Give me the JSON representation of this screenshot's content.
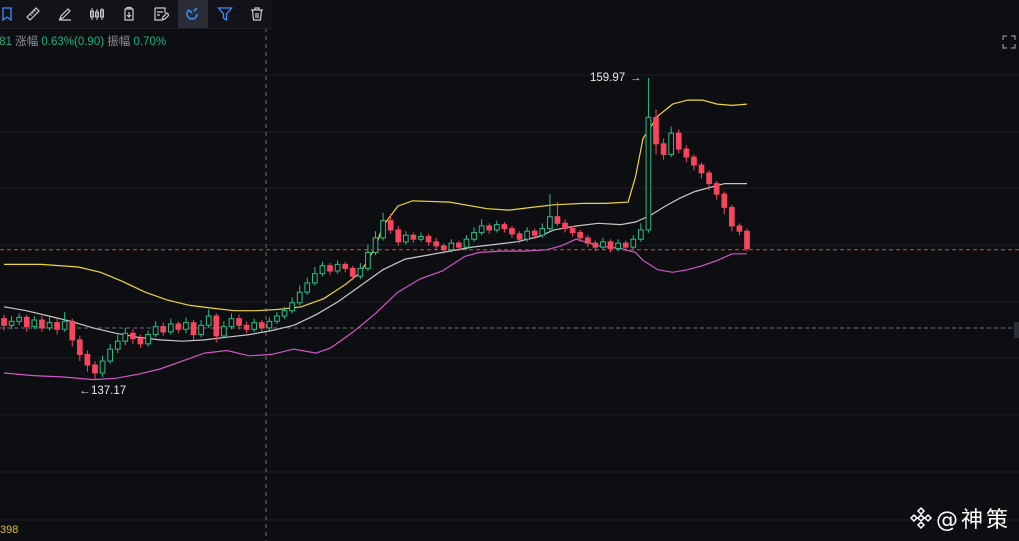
{
  "toolbar": {
    "tools": [
      {
        "name": "bookmark-icon",
        "active": false
      },
      {
        "name": "ruler-icon",
        "active": false
      },
      {
        "name": "pen-icon",
        "active": false
      },
      {
        "name": "candlestick-icon",
        "active": false
      },
      {
        "name": "clipboard-icon",
        "active": false
      },
      {
        "name": "edit-note-icon",
        "active": false
      },
      {
        "name": "magnet-icon",
        "active": true
      },
      {
        "name": "filter-icon",
        "active": false
      },
      {
        "name": "trash-icon",
        "active": false
      }
    ]
  },
  "stats": {
    "partial_value": ".81",
    "change_label": "涨幅",
    "change_value": "0.63%(0.90)",
    "amplitude_label": "振幅",
    "amplitude_value": "0.70%"
  },
  "bottom_value": "398",
  "watermark": {
    "text": "@神策"
  },
  "colors": {
    "up": "#2ebd85",
    "down": "#f6465d",
    "upper_band": "#f0d43a",
    "middle_band": "#c8c8c8",
    "lower_band": "#d455c8",
    "background": "#0d0e12"
  },
  "chart_data": {
    "type": "candlestick",
    "indicator": "bollinger",
    "ylim": [
      133.0,
      163.0
    ],
    "annotations": [
      {
        "text": "159.97",
        "value": 159.97,
        "kind": "high"
      },
      {
        "text": "137.17",
        "value": 137.17,
        "kind": "low"
      }
    ],
    "reference_lines": [
      {
        "value": 147.0,
        "style": "dashed",
        "color": "#d84a4a"
      },
      {
        "value": 141.1,
        "style": "dashed",
        "color": "#6b6e76"
      }
    ],
    "candles": [
      [
        141.8,
        141.3,
        142.1,
        140.9
      ],
      [
        141.3,
        141.6,
        142.0,
        141.0
      ],
      [
        141.6,
        141.9,
        142.2,
        141.3
      ],
      [
        141.9,
        141.2,
        142.1,
        140.8
      ],
      [
        141.2,
        141.7,
        142.0,
        141.0
      ],
      [
        141.7,
        141.1,
        142.0,
        140.8
      ],
      [
        141.1,
        141.5,
        141.9,
        140.9
      ],
      [
        141.5,
        141.0,
        141.8,
        140.6
      ],
      [
        141.0,
        141.6,
        142.3,
        140.8
      ],
      [
        141.6,
        140.2,
        141.8,
        139.7
      ],
      [
        140.2,
        139.1,
        140.5,
        138.6
      ],
      [
        139.1,
        138.3,
        139.4,
        137.8
      ],
      [
        138.3,
        137.7,
        138.6,
        137.17
      ],
      [
        137.7,
        138.6,
        139.0,
        137.4
      ],
      [
        138.6,
        139.5,
        139.9,
        138.4
      ],
      [
        139.5,
        140.1,
        140.6,
        139.2
      ],
      [
        140.1,
        140.7,
        141.1,
        139.8
      ],
      [
        140.7,
        140.3,
        141.0,
        139.9
      ],
      [
        140.3,
        139.9,
        140.6,
        139.6
      ],
      [
        139.9,
        140.6,
        140.9,
        139.7
      ],
      [
        140.6,
        141.2,
        141.6,
        140.4
      ],
      [
        141.2,
        140.8,
        141.5,
        140.5
      ],
      [
        140.8,
        141.4,
        141.8,
        140.6
      ],
      [
        141.4,
        141.0,
        141.6,
        140.7
      ],
      [
        141.0,
        141.5,
        141.9,
        140.7
      ],
      [
        141.5,
        140.6,
        141.7,
        140.2
      ],
      [
        140.6,
        141.3,
        141.7,
        140.4
      ],
      [
        141.3,
        142.0,
        142.5,
        141.1
      ],
      [
        142.0,
        140.5,
        142.2,
        140.0
      ],
      [
        140.5,
        141.2,
        141.6,
        140.3
      ],
      [
        141.2,
        141.8,
        142.2,
        141.0
      ],
      [
        141.8,
        141.3,
        142.1,
        141.0
      ],
      [
        141.3,
        141.0,
        141.6,
        140.7
      ],
      [
        141.0,
        141.5,
        141.8,
        140.8
      ],
      [
        141.5,
        141.1,
        141.7,
        140.8
      ],
      [
        141.1,
        141.6,
        141.9,
        140.9
      ],
      [
        141.6,
        142.0,
        142.3,
        141.4
      ],
      [
        142.0,
        142.4,
        142.7,
        141.8
      ],
      [
        142.4,
        143.0,
        143.4,
        142.2
      ],
      [
        143.0,
        143.8,
        144.3,
        142.8
      ],
      [
        143.8,
        144.5,
        144.9,
        143.6
      ],
      [
        144.5,
        145.2,
        145.7,
        144.3
      ],
      [
        145.2,
        145.8,
        146.1,
        145.0
      ],
      [
        145.8,
        145.4,
        146.0,
        145.1
      ],
      [
        145.4,
        145.9,
        146.2,
        145.2
      ],
      [
        145.9,
        145.6,
        146.1,
        145.3
      ],
      [
        145.6,
        145.0,
        145.8,
        144.7
      ],
      [
        145.0,
        145.6,
        146.0,
        144.8
      ],
      [
        145.6,
        146.8,
        147.4,
        145.4
      ],
      [
        146.8,
        147.9,
        148.4,
        146.6
      ],
      [
        147.9,
        149.2,
        149.8,
        147.7
      ],
      [
        149.2,
        148.5,
        149.7,
        148.2
      ],
      [
        148.5,
        147.6,
        148.8,
        147.3
      ],
      [
        147.6,
        148.1,
        148.4,
        147.4
      ],
      [
        148.1,
        147.8,
        148.3,
        147.5
      ],
      [
        147.8,
        148.0,
        148.3,
        147.6
      ],
      [
        148.0,
        147.6,
        148.2,
        147.3
      ],
      [
        147.6,
        147.3,
        147.9,
        147.0
      ],
      [
        147.3,
        147.0,
        147.5,
        146.7
      ],
      [
        147.0,
        147.5,
        147.8,
        146.8
      ],
      [
        147.5,
        147.2,
        147.7,
        146.9
      ],
      [
        147.2,
        147.8,
        148.1,
        147.0
      ],
      [
        147.8,
        148.3,
        148.7,
        147.6
      ],
      [
        148.3,
        148.8,
        149.3,
        148.1
      ],
      [
        148.8,
        148.5,
        149.0,
        148.2
      ],
      [
        148.5,
        148.9,
        149.2,
        148.3
      ],
      [
        148.9,
        148.6,
        149.1,
        148.3
      ],
      [
        148.6,
        148.2,
        148.8,
        147.9
      ],
      [
        148.2,
        147.8,
        148.4,
        147.5
      ],
      [
        147.8,
        148.4,
        148.7,
        147.6
      ],
      [
        148.4,
        148.1,
        148.6,
        147.8
      ],
      [
        148.1,
        148.6,
        149.0,
        147.9
      ],
      [
        148.6,
        149.5,
        151.2,
        148.4
      ],
      [
        149.5,
        149.0,
        150.6,
        148.8
      ],
      [
        149.0,
        148.6,
        149.3,
        148.3
      ],
      [
        148.6,
        148.3,
        148.8,
        148.0
      ],
      [
        148.3,
        147.9,
        148.5,
        147.6
      ],
      [
        147.9,
        147.5,
        148.1,
        147.2
      ],
      [
        147.5,
        147.2,
        147.7,
        146.9
      ],
      [
        147.2,
        147.6,
        147.9,
        147.0
      ],
      [
        147.6,
        147.1,
        147.8,
        146.8
      ],
      [
        147.1,
        147.5,
        147.8,
        146.9
      ],
      [
        147.5,
        147.2,
        147.7,
        146.9
      ],
      [
        147.2,
        147.8,
        148.1,
        147.0
      ],
      [
        147.8,
        148.5,
        149.0,
        147.6
      ],
      [
        148.5,
        157.0,
        159.97,
        148.3
      ],
      [
        157.0,
        155.0,
        157.6,
        154.2
      ],
      [
        155.0,
        154.2,
        155.4,
        153.8
      ],
      [
        154.2,
        155.8,
        156.3,
        154.0
      ],
      [
        155.8,
        154.6,
        156.1,
        154.3
      ],
      [
        154.6,
        154.0,
        154.9,
        153.6
      ],
      [
        154.0,
        153.4,
        154.2,
        153.0
      ],
      [
        153.4,
        152.8,
        153.6,
        152.4
      ],
      [
        152.8,
        152.0,
        153.0,
        151.5
      ],
      [
        152.0,
        151.2,
        152.2,
        150.8
      ],
      [
        151.2,
        150.2,
        151.4,
        149.7
      ],
      [
        150.2,
        148.8,
        150.4,
        148.4
      ],
      [
        148.8,
        148.4,
        149.0,
        148.1
      ],
      [
        148.4,
        147.1,
        148.6,
        146.9
      ]
    ],
    "upper_band": [
      [
        0,
        145.9
      ],
      [
        5,
        145.9
      ],
      [
        10,
        145.7
      ],
      [
        13,
        145.3
      ],
      [
        16,
        144.6
      ],
      [
        19,
        143.8
      ],
      [
        22,
        143.2
      ],
      [
        25,
        142.8
      ],
      [
        28,
        142.6
      ],
      [
        31,
        142.4
      ],
      [
        34,
        142.4
      ],
      [
        37,
        142.5
      ],
      [
        40,
        142.7
      ],
      [
        43,
        143.3
      ],
      [
        46,
        144.4
      ],
      [
        48,
        145.3
      ],
      [
        50,
        147.2
      ],
      [
        51,
        148.8
      ],
      [
        53,
        150.3
      ],
      [
        55,
        150.7
      ],
      [
        60,
        150.6
      ],
      [
        65,
        150.1
      ],
      [
        68,
        150.0
      ],
      [
        71,
        150.2
      ],
      [
        74,
        150.4
      ],
      [
        78,
        150.5
      ],
      [
        81,
        150.5
      ],
      [
        84,
        150.6
      ],
      [
        85,
        152.5
      ],
      [
        86,
        155.4
      ],
      [
        88,
        157.1
      ],
      [
        90,
        158.0
      ],
      [
        92,
        158.3
      ],
      [
        94,
        158.3
      ],
      [
        96,
        158.0
      ],
      [
        98,
        157.9
      ],
      [
        100,
        158.0
      ]
    ],
    "middle_band": [
      [
        0,
        142.7
      ],
      [
        3,
        142.4
      ],
      [
        6,
        142.0
      ],
      [
        9,
        141.6
      ],
      [
        12,
        141.1
      ],
      [
        15,
        140.7
      ],
      [
        18,
        140.4
      ],
      [
        21,
        140.2
      ],
      [
        24,
        140.1
      ],
      [
        27,
        140.2
      ],
      [
        30,
        140.4
      ],
      [
        33,
        140.6
      ],
      [
        36,
        140.9
      ],
      [
        39,
        141.3
      ],
      [
        42,
        142.1
      ],
      [
        45,
        143.1
      ],
      [
        48,
        144.3
      ],
      [
        51,
        145.5
      ],
      [
        54,
        146.3
      ],
      [
        57,
        146.6
      ],
      [
        60,
        146.9
      ],
      [
        63,
        147.2
      ],
      [
        66,
        147.4
      ],
      [
        69,
        147.6
      ],
      [
        72,
        148.0
      ],
      [
        74,
        148.5
      ],
      [
        77,
        148.8
      ],
      [
        80,
        149.0
      ],
      [
        83,
        148.9
      ],
      [
        85,
        149.1
      ],
      [
        87,
        149.6
      ],
      [
        89,
        150.3
      ],
      [
        91,
        150.9
      ],
      [
        93,
        151.4
      ],
      [
        95,
        151.7
      ],
      [
        97,
        152.0
      ],
      [
        100,
        152.0
      ]
    ],
    "lower_band": [
      [
        0,
        137.7
      ],
      [
        4,
        137.5
      ],
      [
        8,
        137.4
      ],
      [
        12,
        137.2
      ],
      [
        15,
        137.3
      ],
      [
        18,
        137.6
      ],
      [
        21,
        138.0
      ],
      [
        24,
        138.6
      ],
      [
        27,
        139.2
      ],
      [
        30,
        139.4
      ],
      [
        33,
        139.0
      ],
      [
        36,
        139.1
      ],
      [
        39,
        139.5
      ],
      [
        42,
        139.2
      ],
      [
        44,
        139.6
      ],
      [
        47,
        140.8
      ],
      [
        50,
        142.2
      ],
      [
        53,
        143.8
      ],
      [
        56,
        144.8
      ],
      [
        59,
        145.4
      ],
      [
        62,
        146.5
      ],
      [
        64,
        146.8
      ],
      [
        67,
        146.9
      ],
      [
        70,
        146.9
      ],
      [
        73,
        147.0
      ],
      [
        75,
        147.3
      ],
      [
        77,
        147.8
      ],
      [
        80,
        147.3
      ],
      [
        83,
        147.1
      ],
      [
        85,
        146.8
      ],
      [
        86,
        146.2
      ],
      [
        88,
        145.5
      ],
      [
        90,
        145.3
      ],
      [
        92,
        145.5
      ],
      [
        94,
        145.8
      ],
      [
        96,
        146.2
      ],
      [
        98,
        146.7
      ],
      [
        100,
        146.7
      ]
    ]
  }
}
